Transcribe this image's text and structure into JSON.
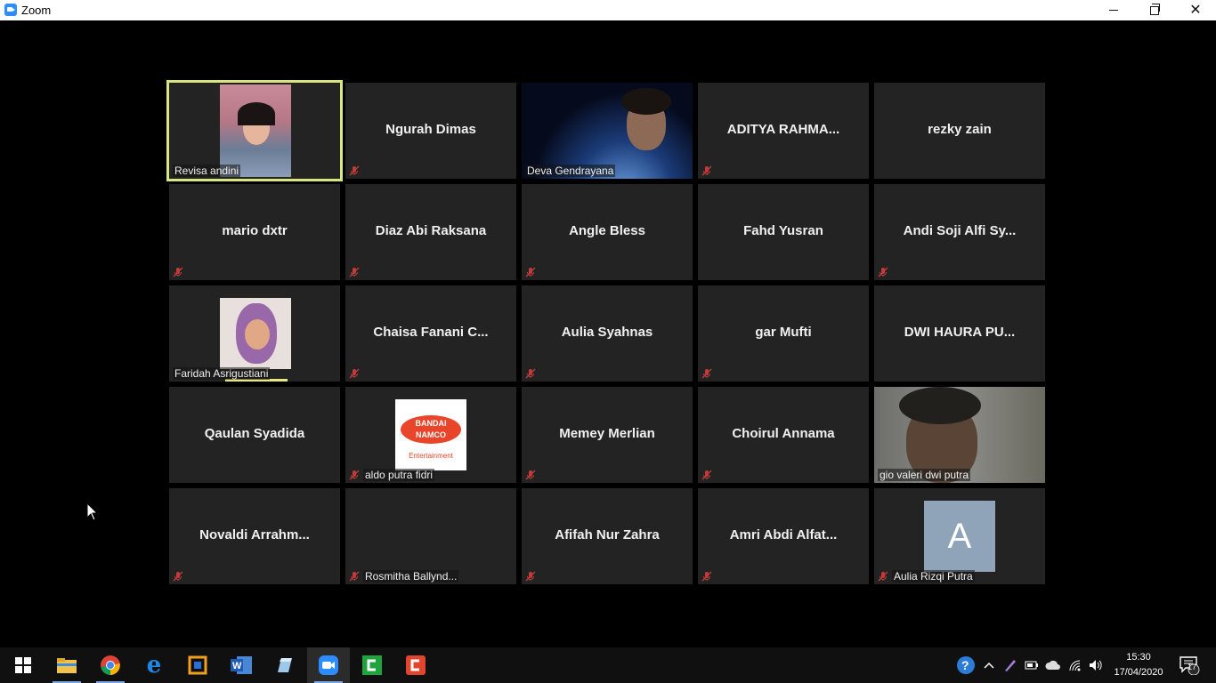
{
  "window": {
    "title": "Zoom"
  },
  "participants": [
    {
      "name": "Revisa andini",
      "video": true,
      "muted": false,
      "active_speaker": true
    },
    {
      "name": "Ngurah Dimas",
      "video": false,
      "muted": true
    },
    {
      "name": "Deva Gendrayana",
      "video": true,
      "muted": false
    },
    {
      "name": "ADITYA  RAHMA...",
      "video": false,
      "muted": true
    },
    {
      "name": "rezky zain",
      "video": false,
      "muted": false
    },
    {
      "name": "mario dxtr",
      "video": false,
      "muted": true
    },
    {
      "name": "Diaz Abi Raksana",
      "video": false,
      "muted": true
    },
    {
      "name": "Angle Bless",
      "video": false,
      "muted": true
    },
    {
      "name": "Fahd Yusran",
      "video": false,
      "muted": false
    },
    {
      "name": "Andi Soji Alfi Sy...",
      "video": false,
      "muted": true
    },
    {
      "name": "Faridah Asrigustiani",
      "video": true,
      "muted": false
    },
    {
      "name": "Chaisa  Fanani  C...",
      "video": false,
      "muted": true
    },
    {
      "name": "Aulia Syahnas",
      "video": false,
      "muted": true
    },
    {
      "name": "gar Mufti",
      "video": false,
      "muted": true
    },
    {
      "name": "DWI HAURA PU...",
      "video": false,
      "muted": false
    },
    {
      "name": "Qaulan Syadida",
      "video": false,
      "muted": false
    },
    {
      "name": "aldo putra fidri",
      "video": true,
      "muted": true,
      "logo_text": [
        "BANDAI",
        "NAMCO",
        "Entertainment"
      ]
    },
    {
      "name": "Memey Merlian",
      "video": false,
      "muted": true
    },
    {
      "name": "Choirul Annama",
      "video": false,
      "muted": true
    },
    {
      "name": "gio valeri dwi putra",
      "video": true,
      "muted": false
    },
    {
      "name": "Novaldi  Arrahm...",
      "video": false,
      "muted": true
    },
    {
      "name": "Rosmitha Ballynd...",
      "video": false,
      "muted": true,
      "label_only": true
    },
    {
      "name": "Afifah Nur Zahra",
      "video": false,
      "muted": true
    },
    {
      "name": "Amri Abdi Alfat...",
      "video": false,
      "muted": true
    },
    {
      "name": "Aulia Rizqi Putra",
      "video": true,
      "muted": true,
      "avatar_letter": "A"
    }
  ],
  "taskbar": {
    "apps": [
      "start-icon",
      "file-explorer-icon",
      "chrome-icon",
      "edge-icon",
      "app-icon",
      "word-icon",
      "app-icon",
      "zoom-icon",
      "camtasia-icon",
      "app-icon"
    ],
    "clock_time": "15:30",
    "clock_date": "17/04/2020",
    "notification_count": "17"
  },
  "colors": {
    "tile_bg": "#232323",
    "active_border": "#d8e682",
    "mute_red": "#c23b3b",
    "zoom_blue": "#2d8cff"
  }
}
